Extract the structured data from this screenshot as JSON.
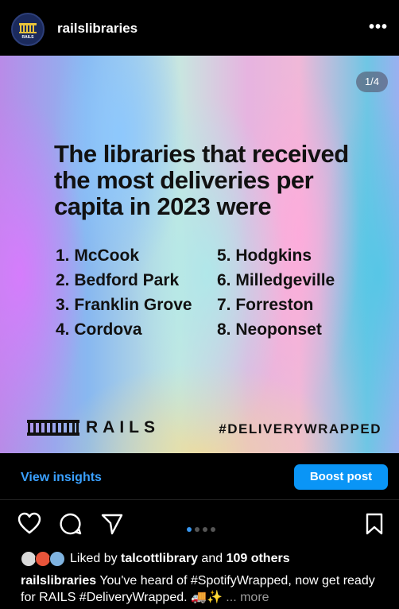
{
  "header": {
    "avatar_text": "RAILS",
    "username": "railslibraries",
    "more_label": "•••"
  },
  "post": {
    "counter": "1/4",
    "headline": "The libraries that received the most deliveries per capita in 2023 were",
    "list_left": [
      "1. McCook",
      "2. Bedford Park",
      "3. Franklin Grove",
      "4. Cordova"
    ],
    "list_right": [
      "5. Hodgkins",
      "6. Milledgeville",
      "7. Forreston",
      "8. Neoponset"
    ],
    "brand": "RAILS",
    "hashtag": "#DELIVERYWRAPPED"
  },
  "insights": {
    "view_label": "View insights",
    "boost_label": "Boost post"
  },
  "actions": {
    "icons": [
      "heart-icon",
      "comment-icon",
      "share-icon",
      "bookmark-icon"
    ],
    "carousel_total": 4,
    "carousel_active": 1
  },
  "likes": {
    "prefix": "Liked by ",
    "user": "talcottlibrary",
    "middle": " and ",
    "others": "109 others"
  },
  "caption": {
    "username": "railslibraries",
    "text": " You've heard of #SpotifyWrapped, now get ready for RAILS #DeliveryWrapped. 🚚✨",
    "more": " ... more"
  },
  "colors": {
    "accent": "#0a95f6",
    "link": "#3aa0ff",
    "background": "#000000",
    "text_dark": "#111111"
  }
}
